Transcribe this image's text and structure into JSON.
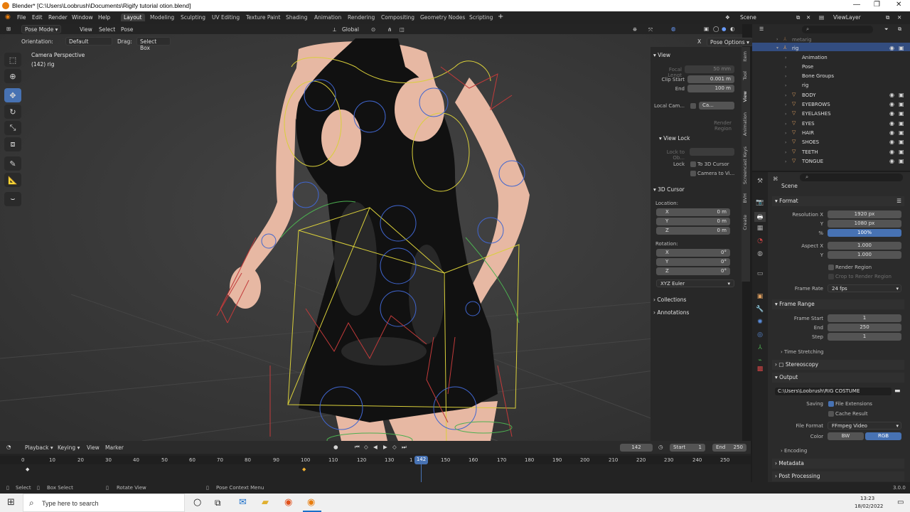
{
  "window": {
    "title": "Blender* [C:\\Users\\Loobrush\\Documents\\Rigify tutorial otion.blend]"
  },
  "menu": [
    "File",
    "Edit",
    "Render",
    "Window",
    "Help"
  ],
  "workspaces": [
    "Layout",
    "Modeling",
    "Sculpting",
    "UV Editing",
    "Texture Paint",
    "Shading",
    "Animation",
    "Rendering",
    "Compositing",
    "Geometry Nodes",
    "Scripting"
  ],
  "topbar": {
    "scene": "Scene",
    "view_layer": "ViewLayer"
  },
  "viewport": {
    "mode": "Pose Mode",
    "menus": [
      "View",
      "Select",
      "Pose"
    ],
    "transform": "Global",
    "orientation_label": "Orientation:",
    "orientation_value": "Default",
    "drag_label": "Drag:",
    "drag_value": "Select Box",
    "pose_options": "Pose Options",
    "overlay_line1": "Camera Perspective",
    "overlay_line2": "(142) rig"
  },
  "npanel": {
    "tabs": [
      "Item",
      "Tool",
      "View",
      "Animation",
      "Screencast Keys",
      "BVH",
      "Create"
    ],
    "view_header": "View",
    "focal_length_label": "Focal Lengt",
    "focal_length": "50 mm",
    "clip_start_label": "Clip Start",
    "clip_start": "0.001 m",
    "end_label": "End",
    "end": "100 m",
    "local_camera_label": "Local Cam...",
    "local_camera_value": "Ca...",
    "render_region": "Render Region",
    "view_lock_header": "View Lock",
    "lock_to_obj_label": "Lock to Ob...",
    "lock_label": "Lock",
    "lock_3d_cursor": "To 3D Cursor",
    "lock_camera_view": "Camera to Vi...",
    "cursor_header": "3D Cursor",
    "location_label": "Location:",
    "loc_x": "0 m",
    "loc_y": "0 m",
    "loc_z": "0 m",
    "rotation_label": "Rotation:",
    "rot_x": "0°",
    "rot_y": "0°",
    "rot_z": "0°",
    "axis_x": "X",
    "axis_y": "Y",
    "axis_z": "Z",
    "rotation_mode": "XYZ Euler",
    "collections": "Collections",
    "annotations": "Annotations"
  },
  "outliner": {
    "items": [
      {
        "label": "metarig",
        "depth": 0
      },
      {
        "label": "rig",
        "depth": 0
      },
      {
        "label": "Animation",
        "depth": 1
      },
      {
        "label": "Pose",
        "depth": 1
      },
      {
        "label": "Bone Groups",
        "depth": 1
      },
      {
        "label": "rig",
        "depth": 1
      },
      {
        "label": "BODY",
        "depth": 1
      },
      {
        "label": "EYEBROWS",
        "depth": 1
      },
      {
        "label": "EYELASHES",
        "depth": 1
      },
      {
        "label": "EYES",
        "depth": 1
      },
      {
        "label": "HAIR",
        "depth": 1
      },
      {
        "label": "SHOES",
        "depth": 1
      },
      {
        "label": "TEETH",
        "depth": 1
      },
      {
        "label": "TONGUE",
        "depth": 1
      }
    ]
  },
  "properties": {
    "context": "Scene",
    "format_header": "Format",
    "res_x_label": "Resolution X",
    "res_x": "1920 px",
    "res_y_label": "Y",
    "res_y": "1080 px",
    "res_pct_label": "%",
    "res_pct": "100%",
    "aspect_x_label": "Aspect X",
    "aspect_x": "1.000",
    "aspect_y_label": "Y",
    "aspect_y": "1.000",
    "render_region": "Render Region",
    "crop_region": "Crop to Render Region",
    "frame_rate_label": "Frame Rate",
    "frame_rate": "24 fps",
    "frame_range_header": "Frame Range",
    "frame_start_label": "Frame Start",
    "frame_start": "1",
    "frame_end_label": "End",
    "frame_end": "250",
    "step_label": "Step",
    "step": "1",
    "time_stretching": "Time Stretching",
    "stereoscopy": "Stereoscopy",
    "output_header": "Output",
    "output_path": "C:\\Users\\Loobrush\\RIG COSTUME",
    "saving_label": "Saving",
    "file_extensions": "File Extensions",
    "cache_result": "Cache Result",
    "file_format_label": "File Format",
    "file_format": "FFmpeg Video",
    "color_label": "Color",
    "color_bw": "BW",
    "color_rgb": "RGB",
    "encoding": "Encoding",
    "metadata": "Metadata",
    "post_processing": "Post Processing"
  },
  "timeline": {
    "menus": [
      "Playback",
      "Keying",
      "View",
      "Marker"
    ],
    "current_frame": "142",
    "start_label": "Start",
    "start": "1",
    "end_label": "End",
    "end": "250",
    "ticks": [
      "0",
      "10",
      "20",
      "30",
      "40",
      "50",
      "60",
      "70",
      "80",
      "90",
      "100",
      "110",
      "120",
      "130",
      "1",
      "142",
      "150",
      "160",
      "170",
      "180",
      "190",
      "200",
      "210",
      "220",
      "230",
      "240",
      "250"
    ]
  },
  "statusbar": {
    "select": "Select",
    "box_select": "Box Select",
    "rotate_view": "Rotate View",
    "context_menu": "Pose Context Menu",
    "version": "3.0.0"
  },
  "taskbar": {
    "search_placeholder": "Type here to search",
    "time": "13:23",
    "date": "18/02/2022"
  }
}
